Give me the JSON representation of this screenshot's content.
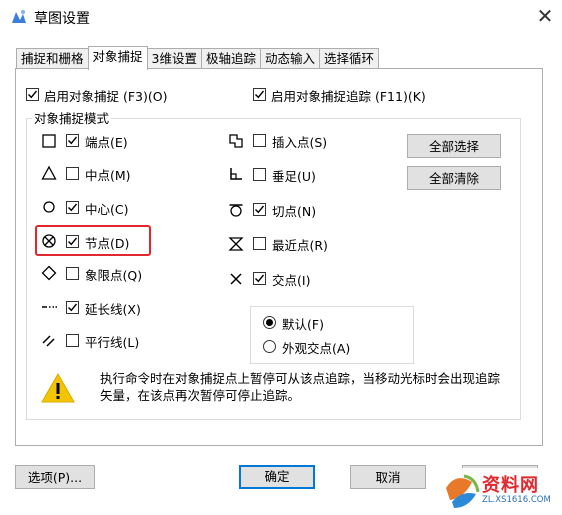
{
  "window": {
    "title": "草图设置",
    "close_glyph": "✕"
  },
  "tabs": [
    {
      "label": "捕捉和栅格",
      "active": false
    },
    {
      "label": "对象捕捉",
      "active": true
    },
    {
      "label": "3维设置",
      "active": false
    },
    {
      "label": "极轴追踪",
      "active": false
    },
    {
      "label": "动态输入",
      "active": false
    },
    {
      "label": "选择循环",
      "active": false
    }
  ],
  "osnap": {
    "enable_label": "启用对象捕捉 (F3)(O)",
    "enable_checked": true,
    "tracking_label": "启用对象捕捉追踪 (F11)(K)",
    "tracking_checked": true,
    "group_title": "对象捕捉模式",
    "left_modes": [
      {
        "name": "endpoint",
        "label": "端点(E)",
        "checked": true,
        "marker": "square"
      },
      {
        "name": "midpoint",
        "label": "中点(M)",
        "checked": false,
        "marker": "triangle"
      },
      {
        "name": "center",
        "label": "中心(C)",
        "checked": true,
        "marker": "circle"
      },
      {
        "name": "node",
        "label": "节点(D)",
        "checked": true,
        "marker": "node"
      },
      {
        "name": "quadrant",
        "label": "象限点(Q)",
        "checked": false,
        "marker": "diamond"
      },
      {
        "name": "extension",
        "label": "延长线(X)",
        "checked": true,
        "marker": "extension"
      },
      {
        "name": "parallel",
        "label": "平行线(L)",
        "checked": false,
        "marker": "parallel"
      }
    ],
    "right_modes": [
      {
        "name": "insertion",
        "label": "插入点(S)",
        "checked": false,
        "marker": "insertion"
      },
      {
        "name": "perpendicular",
        "label": "垂足(U)",
        "checked": false,
        "marker": "perpendicular"
      },
      {
        "name": "tangent",
        "label": "切点(N)",
        "checked": true,
        "marker": "tangent"
      },
      {
        "name": "nearest",
        "label": "最近点(R)",
        "checked": false,
        "marker": "nearest"
      },
      {
        "name": "intersection",
        "label": "交点(I)",
        "checked": true,
        "marker": "intersection"
      }
    ],
    "select_all_label": "全部选择",
    "clear_all_label": "全部清除",
    "radios": [
      {
        "label": "默认(F)",
        "selected": true
      },
      {
        "label": "外观交点(A)",
        "selected": false
      }
    ],
    "warning_text": "执行命令时在对象捕捉点上暂停可从该点追踪，当移动光标时会出现追踪矢量，在该点再次暂停可停止追踪。"
  },
  "footer": {
    "options_label": "选项(P)...",
    "ok_label": "确定",
    "cancel_label": "取消"
  },
  "watermark": {
    "text": "资料网",
    "sub": "ZL.XS1616.COM"
  },
  "colors": {
    "highlight": "#e0282e",
    "focus_border": "#0078d7",
    "warning": "#f2c500"
  }
}
